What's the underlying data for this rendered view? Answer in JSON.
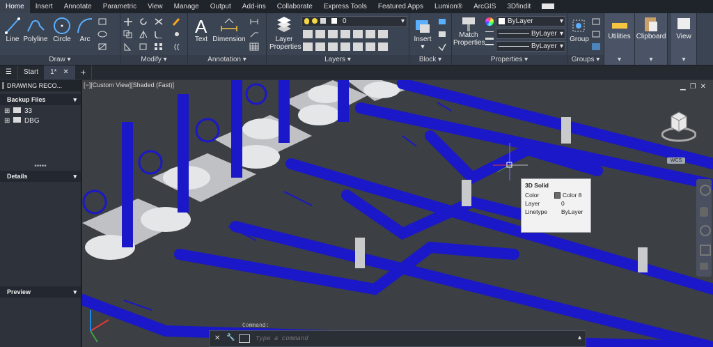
{
  "ribbon_tabs": [
    "Home",
    "Insert",
    "Annotate",
    "Parametric",
    "View",
    "Manage",
    "Output",
    "Add-ins",
    "Collaborate",
    "Express Tools",
    "Featured Apps",
    "Lumion®",
    "ArcGIS",
    "3Dfindit"
  ],
  "draw": {
    "title": "Draw",
    "line": "Line",
    "polyline": "Polyline",
    "circle": "Circle",
    "arc": "Arc"
  },
  "modify": {
    "title": "Modify"
  },
  "annotation": {
    "title": "Annotation",
    "text": "Text",
    "dimension": "Dimension"
  },
  "layers": {
    "title": "Layers",
    "layer_properties": "Layer\nProperties",
    "current_layer": "0"
  },
  "block": {
    "title": "Block",
    "insert": "Insert"
  },
  "properties": {
    "title": "Properties",
    "match": "Match\nProperties",
    "color": "ByLayer",
    "lineweight": "ByLayer",
    "linetype": "ByLayer"
  },
  "groups": {
    "title": "Groups",
    "group": "Group"
  },
  "utilities": "Utilities",
  "clipboard": "Clipboard",
  "view": "View",
  "doc_tabs": {
    "start": "Start",
    "drawing": "1*"
  },
  "left_panel": {
    "title": "DRAWING RECO...",
    "backup_files": "Backup Files",
    "tree": [
      "33",
      "DBG"
    ],
    "details": "Details",
    "preview": "Preview"
  },
  "viewport": {
    "label": "[−][Custom View][Shaded (Fast)]",
    "wcs": "WCS"
  },
  "tooltip": {
    "title": "3D Solid",
    "rows": [
      {
        "k": "Color",
        "v": "Color 8"
      },
      {
        "k": "Layer",
        "v": "0"
      },
      {
        "k": "Linetype",
        "v": "ByLayer"
      }
    ]
  },
  "command": {
    "history": "Command:",
    "placeholder": "Type a command"
  }
}
